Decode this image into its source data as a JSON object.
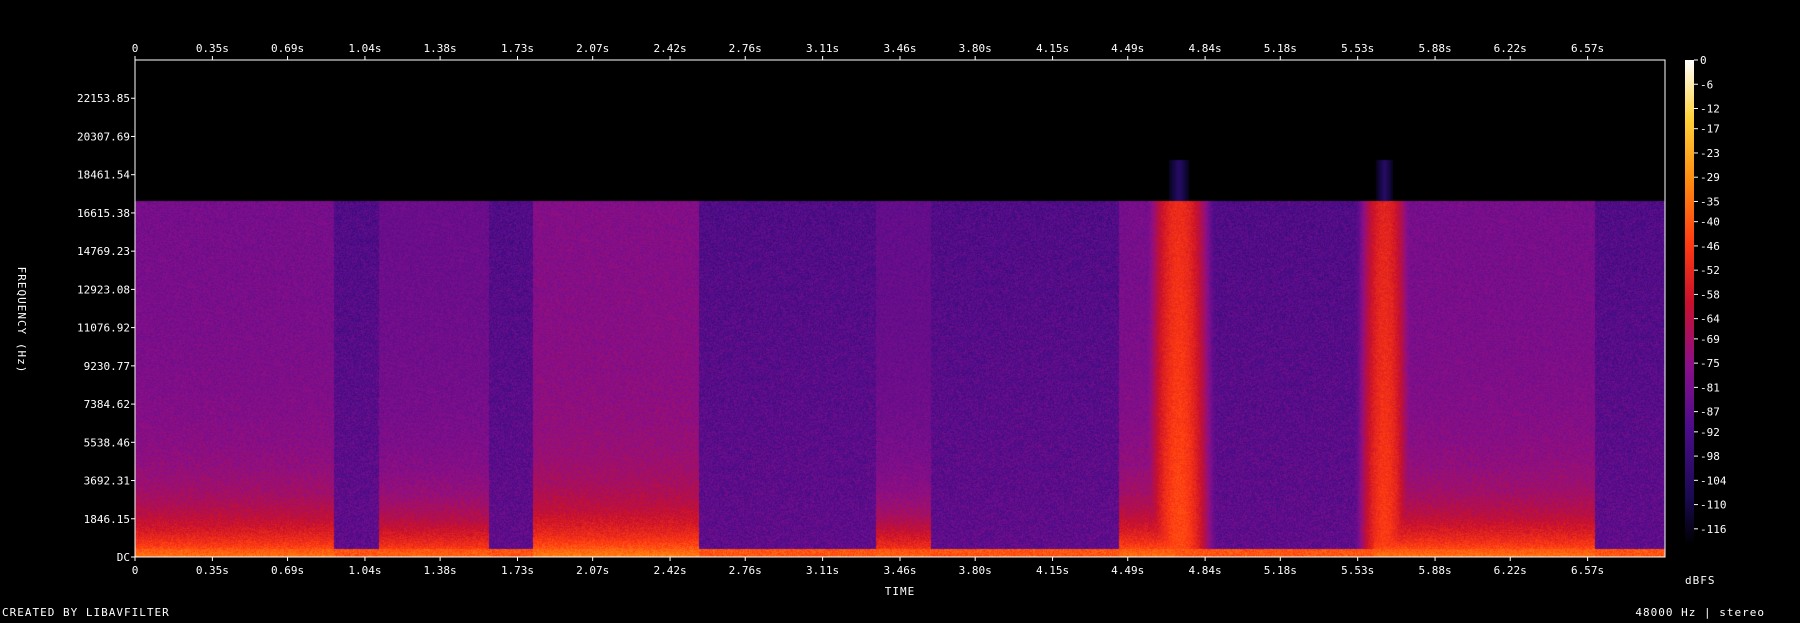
{
  "chart_data": {
    "type": "heatmap",
    "title": "",
    "xlabel": "TIME",
    "ylabel": "FREQUENCY (Hz)",
    "colorbar_label": "dBFS",
    "x_ticks": [
      "0",
      "0.35s",
      "0.69s",
      "1.04s",
      "1.38s",
      "1.73s",
      "2.07s",
      "2.42s",
      "2.76s",
      "3.11s",
      "3.46s",
      "3.80s",
      "4.15s",
      "4.49s",
      "4.84s",
      "5.18s",
      "5.53s",
      "5.88s",
      "6.22s",
      "6.57s"
    ],
    "x_tick_values": [
      0,
      0.35,
      0.69,
      1.04,
      1.38,
      1.73,
      2.07,
      2.42,
      2.76,
      3.11,
      3.46,
      3.8,
      4.15,
      4.49,
      4.84,
      5.18,
      5.53,
      5.88,
      6.22,
      6.57
    ],
    "xlim": [
      0,
      6.92
    ],
    "y_ticks": [
      "DC",
      "1846.15",
      "3692.31",
      "5538.46",
      "7384.62",
      "9230.77",
      "11076.92",
      "12923.08",
      "14769.23",
      "16615.38",
      "18461.54",
      "20307.69",
      "22153.85"
    ],
    "y_tick_values": [
      0,
      1846.15,
      3692.31,
      5538.46,
      7384.62,
      9230.77,
      11076.92,
      12923.08,
      14769.23,
      16615.38,
      18461.54,
      20307.69,
      22153.85
    ],
    "ylim": [
      0,
      24000
    ],
    "colorbar_ticks": [
      "0",
      "-6",
      "-12",
      "-17",
      "-23",
      "-29",
      "-35",
      "-40",
      "-46",
      "-52",
      "-58",
      "-64",
      "-69",
      "-75",
      "-81",
      "-87",
      "-92",
      "-98",
      "-104",
      "-110",
      "-116"
    ],
    "colorbar_values": [
      0,
      -6,
      -12,
      -17,
      -23,
      -29,
      -35,
      -40,
      -46,
      -52,
      -58,
      -64,
      -69,
      -75,
      -81,
      -87,
      -92,
      -98,
      -104,
      -110,
      -116
    ],
    "colorbar_range": [
      -120,
      0
    ],
    "colormap": [
      "#000000",
      "#1a0a52",
      "#4b0c8a",
      "#8a0f8a",
      "#c8102c",
      "#ff3a12",
      "#ff8a10",
      "#ffd23a",
      "#ffffff"
    ],
    "frequency_cutoff_hz": 17200,
    "background_level_dbfs": -85,
    "transients": [
      {
        "time": 4.72,
        "level_dbfs": -42,
        "width_s": 0.06
      },
      {
        "time": 5.65,
        "level_dbfs": -45,
        "width_s": 0.05
      }
    ],
    "speech_segments": [
      {
        "start": 0.0,
        "end": 0.9,
        "level_dbfs": -55
      },
      {
        "start": 1.1,
        "end": 1.6,
        "level_dbfs": -58
      },
      {
        "start": 1.8,
        "end": 2.55,
        "level_dbfs": -52
      },
      {
        "start": 3.35,
        "end": 3.6,
        "level_dbfs": -60
      },
      {
        "start": 4.45,
        "end": 4.7,
        "level_dbfs": -55
      },
      {
        "start": 5.6,
        "end": 6.6,
        "level_dbfs": -55
      }
    ]
  },
  "footer": {
    "credit": "CREATED BY LIBAVFILTER",
    "format": "48000 Hz | stereo"
  }
}
